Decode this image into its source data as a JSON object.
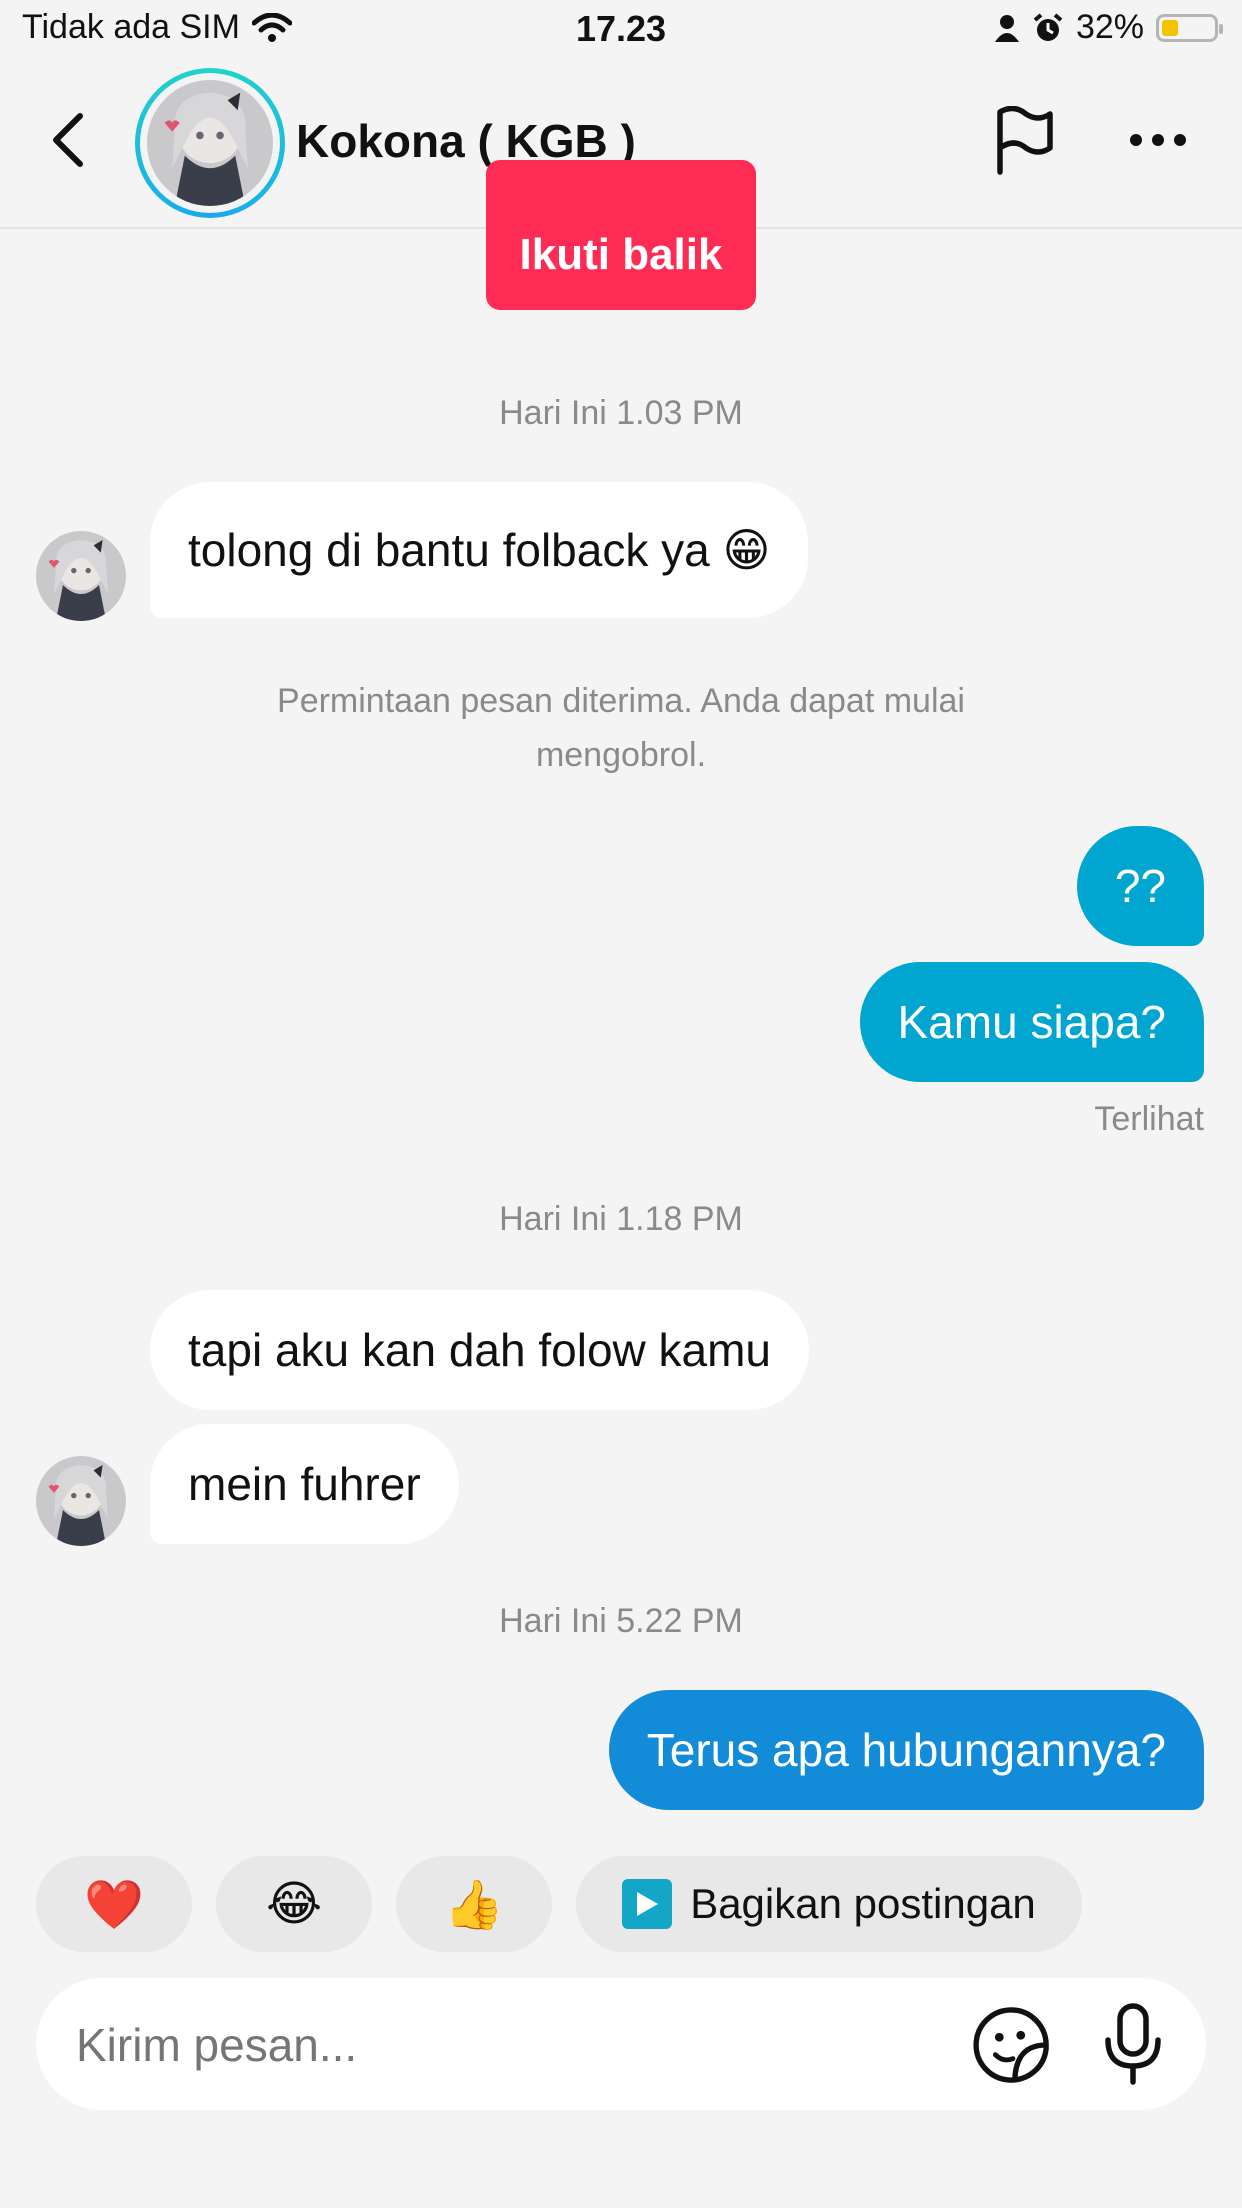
{
  "status_bar": {
    "carrier": "Tidak ada SIM",
    "time": "17.23",
    "battery_percent": "32%",
    "battery_level": 0.32,
    "icons": [
      "wifi-icon",
      "person-icon",
      "alarm-icon",
      "battery-icon"
    ]
  },
  "header": {
    "name": "Kokona ( KGB )",
    "icons": [
      "back-arrow-icon",
      "avatar",
      "flag-icon",
      "more-icon"
    ]
  },
  "follow_back_label": "Ikuti balik",
  "messages": {
    "ts1": "Hari Ini 1.03 PM",
    "m1": "tolong di bantu folback ya 😁",
    "system": "Permintaan pesan diterima. Anda dapat mulai mengobrol.",
    "m2": "??",
    "m3": "Kamu siapa?",
    "seen": "Terlihat",
    "ts2": "Hari Ini 1.18 PM",
    "m4": "tapi aku kan dah folow kamu",
    "m5": "mein fuhrer",
    "ts3": "Hari Ini 5.22 PM",
    "m6": "Terus apa hubungannya?"
  },
  "quick_replies": {
    "heart": "❤️",
    "laugh": "😂",
    "thumbs": "👍",
    "share_label": "Bagikan postingan"
  },
  "input": {
    "placeholder": "Kirim pesan..."
  },
  "colors": {
    "bubble_out": "#00a6cf",
    "bubble_out_latest": "#128cd8",
    "follow_button": "#fe2c55",
    "background": "#f4f4f4"
  }
}
